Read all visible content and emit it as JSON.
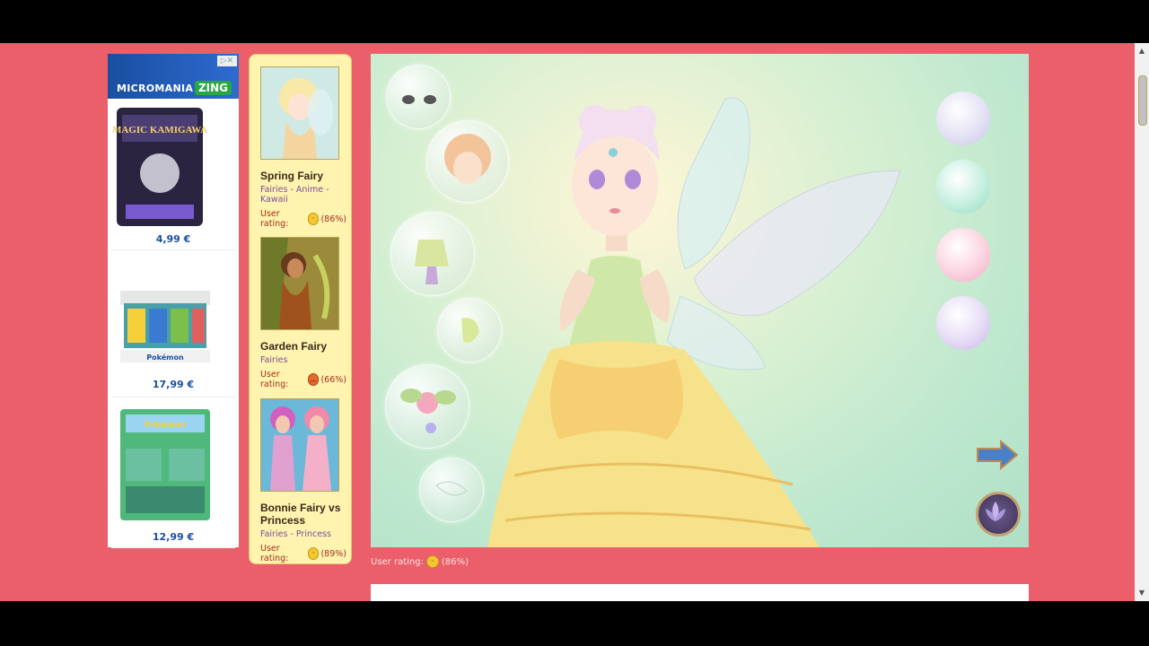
{
  "ad": {
    "brand": "MICROMANIA",
    "partner": "ZING",
    "items": [
      {
        "price": "4,99 €",
        "label": "MAGIC KAMIGAWA"
      },
      {
        "price": "17,99 €",
        "label": "Pokémon"
      },
      {
        "price": "12,99 €",
        "label": "Pokémon"
      }
    ]
  },
  "games": [
    {
      "title": "Spring Fairy",
      "category": "Fairies - Anime - Kawaii",
      "rating_label": "User rating:",
      "rating": "(86%)"
    },
    {
      "title": "Garden Fairy",
      "category": "Fairies",
      "rating_label": "User rating:",
      "rating": "(66%)"
    },
    {
      "title": "Bonnie Fairy vs Princess",
      "category": "Fairies - Princess",
      "rating_label": "User rating:",
      "rating": "(89%)"
    }
  ],
  "below": {
    "rating_label": "User rating:",
    "rating": "(86%)"
  },
  "colors": {
    "page_bg": "#ea5f6a",
    "games_bg": "#fff3b0",
    "canvas_bg": "#bfe8cf"
  },
  "toolbar": {
    "icons": [
      "cursor-icon",
      "pen-icon",
      "eraser-icon",
      "pause-icon",
      "chevron-left-icon"
    ]
  }
}
